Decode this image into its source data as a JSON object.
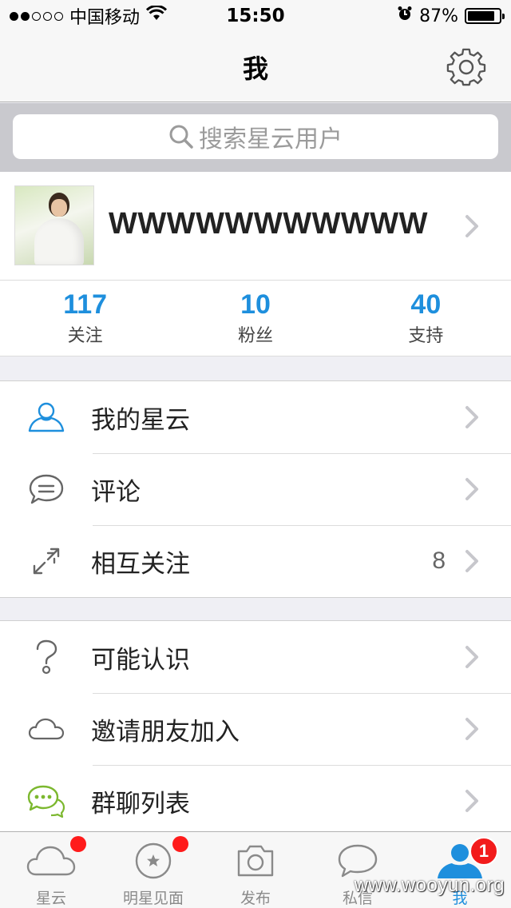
{
  "status_bar": {
    "carrier": "中国移动",
    "time": "15:50",
    "battery": "87%",
    "battery_level": 0.87
  },
  "header": {
    "title": "我",
    "settings_icon": "gear-icon"
  },
  "search": {
    "placeholder": "搜索星云用户"
  },
  "profile": {
    "username": "WWWWWWWWWWWW..."
  },
  "stats": [
    {
      "value": "117",
      "label": "关注"
    },
    {
      "value": "10",
      "label": "粉丝"
    },
    {
      "value": "40",
      "label": "支持"
    }
  ],
  "menu_group_1": [
    {
      "label": "我的星云",
      "icon": "person-outline-icon"
    },
    {
      "label": "评论",
      "icon": "comment-bubble-icon"
    },
    {
      "label": "相互关注",
      "icon": "arrows-exchange-icon",
      "count": "8"
    }
  ],
  "menu_group_2": [
    {
      "label": "可能认识",
      "icon": "question-mark-icon"
    },
    {
      "label": "邀请朋友加入",
      "icon": "cloud-icon"
    },
    {
      "label": "群聊列表",
      "icon": "group-chat-icon"
    }
  ],
  "tabs": [
    {
      "label": "星云",
      "icon": "cloud-icon",
      "dot": true
    },
    {
      "label": "明星见面",
      "icon": "star-circle-icon",
      "dot": true
    },
    {
      "label": "发布",
      "icon": "camera-icon"
    },
    {
      "label": "私信",
      "icon": "speech-bubble-icon"
    },
    {
      "label": "我",
      "icon": "person-icon",
      "badge": "1",
      "active": true
    }
  ],
  "watermark": "www.wooyun.org",
  "colors": {
    "accent": "#1e8fdd",
    "badge_red": "#f21b1b",
    "group_chat_green": "#7cb82f"
  }
}
